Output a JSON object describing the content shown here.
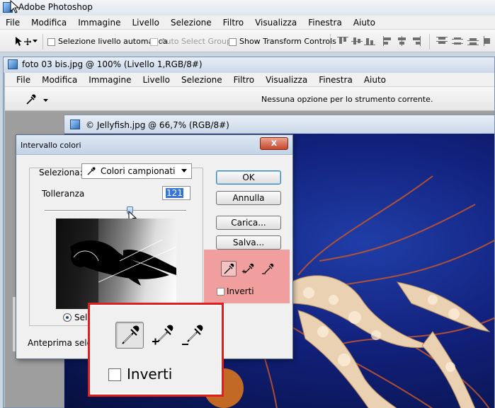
{
  "app": {
    "title": "Adobe Photoshop",
    "menu": [
      "File",
      "Modifica",
      "Immagine",
      "Livello",
      "Selezione",
      "Filtro",
      "Visualizza",
      "Finestra",
      "Aiuto"
    ]
  },
  "options_bar": {
    "auto_select_layer": "Selezione livello automatica",
    "auto_select_groups": "Auto Select Groups",
    "show_transform": "Show Transform Controls"
  },
  "doc1": {
    "title": "foto 03 bis.jpg @ 100% (Livello 1,RGB/8#)",
    "menu": [
      "File",
      "Modifica",
      "Immagine",
      "Livello",
      "Selezione",
      "Filtro",
      "Visualizza",
      "Finestra",
      "Aiuto"
    ],
    "tool_message": "Nessuna opzione per lo strumento corrente."
  },
  "doc2": {
    "title": "© Jellyfish.jpg @ 66,7% (RGB/8#)"
  },
  "dialog": {
    "title": "Intervallo colori",
    "close": "x",
    "seleziona_label": "Seleziona:",
    "seleziona_value": "Colori campionati",
    "tolleranza_label": "Tolleranza",
    "tolleranza_value": "121",
    "tolleranza_fraction": 0.6,
    "radio_selection_label": "Sele",
    "anteprima_label": "Anteprima selez",
    "buttons": {
      "ok": "OK",
      "annulla": "Annulla",
      "carica": "Carica...",
      "salva": "Salva..."
    },
    "inverti_label": "Inverti"
  },
  "callout": {
    "inverti_label": "Inverti"
  },
  "colors": {
    "highlight_zone": "#f19e9e",
    "callout_border": "#e01e1e",
    "selection_blue": "#3875d7"
  }
}
